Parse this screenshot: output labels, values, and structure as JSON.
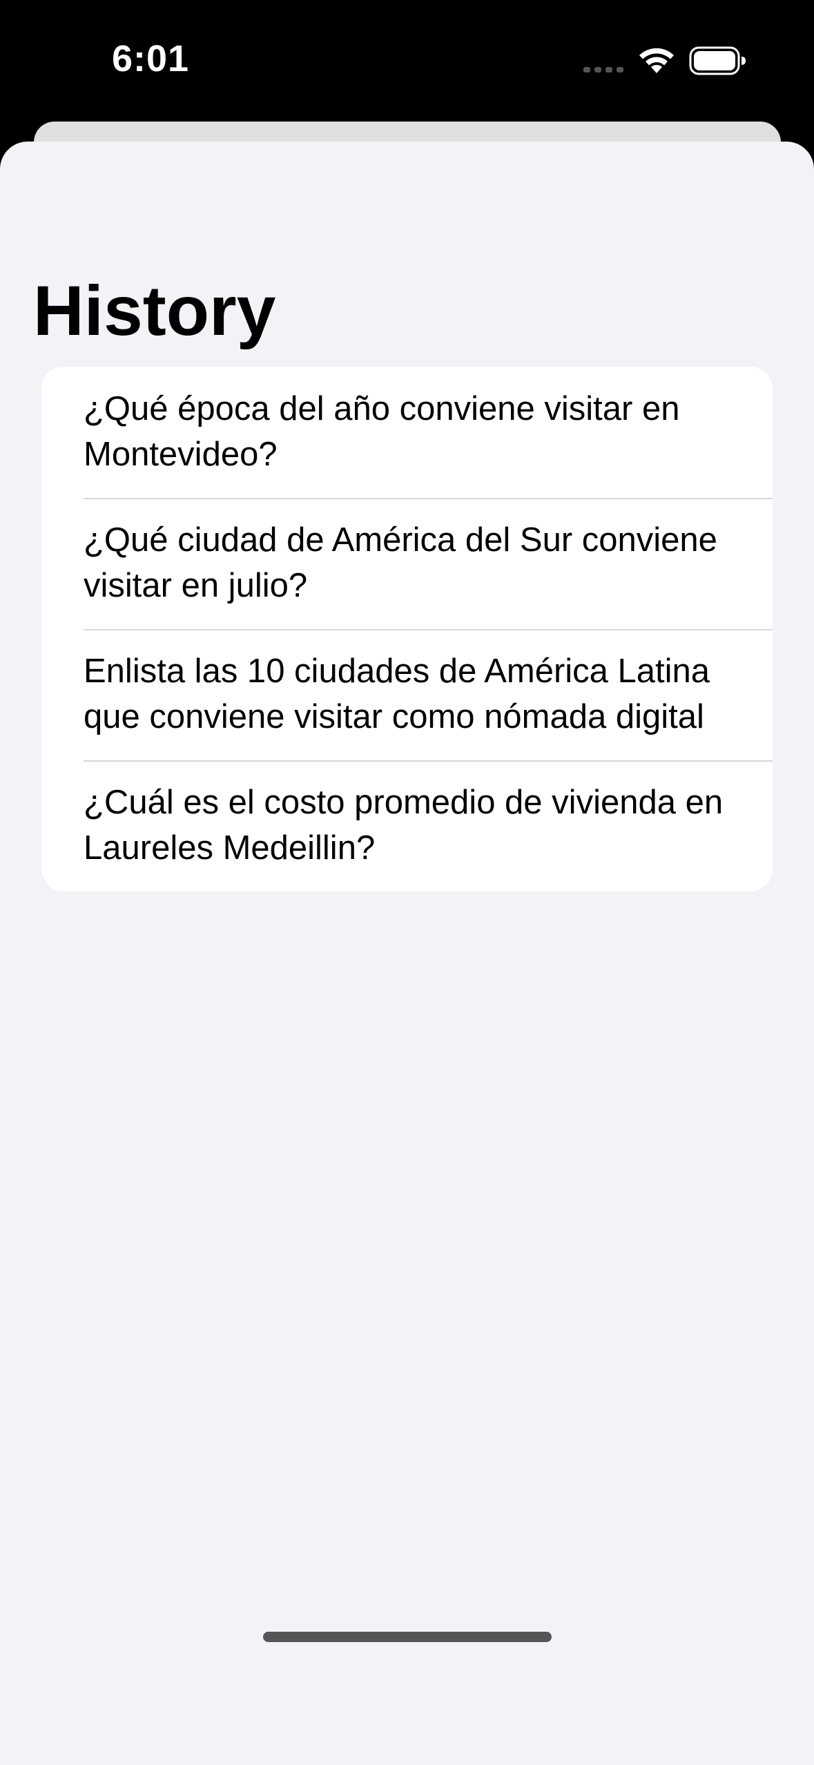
{
  "status_bar": {
    "time": "6:01"
  },
  "header": {
    "title": "History"
  },
  "history": {
    "items": [
      {
        "label": "¿Qué época del año conviene visitar en Montevideo?"
      },
      {
        "label": "¿Qué ciudad de América del Sur conviene visitar en julio?"
      },
      {
        "label": "Enlista las 10 ciudades de América Latina que conviene visitar como nómada digital"
      },
      {
        "label": "¿Cuál es el costo promedio de vivienda en Laureles Medeillin?"
      }
    ]
  },
  "icons": {
    "signal": "cellular-signal-icon",
    "wifi": "wifi-icon",
    "battery": "battery-icon"
  },
  "colors": {
    "status_bar_bg": "#000000",
    "sheet_bg": "#f2f2f7",
    "card_bg": "#ffffff",
    "separator": "#d6d6d9",
    "text": "#000000"
  }
}
